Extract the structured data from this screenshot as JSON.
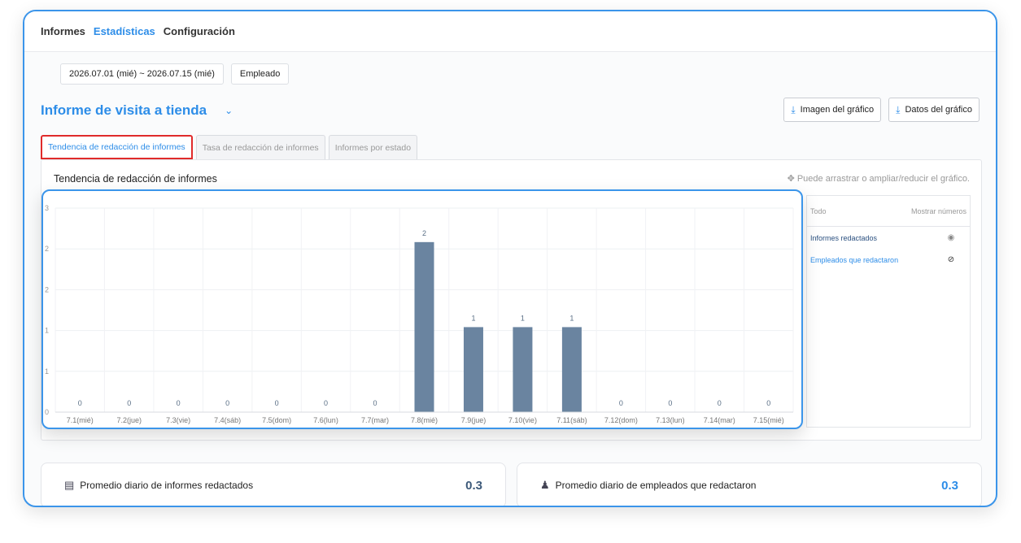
{
  "nav": [
    "Informes",
    "Estadísticas",
    "Configuración"
  ],
  "filters": {
    "date_range": "2026.07.01 (mié) ~ 2026.07.15 (mié)",
    "group": "Empleado"
  },
  "page_title": "Informe de visita a tienda",
  "downloads": {
    "image": "Imagen del gráfico",
    "data": "Datos del gráfico"
  },
  "tabs": [
    "Tendencia de redacción de informes",
    "Tasa de redacción de informes",
    "Informes por estado"
  ],
  "panel": {
    "title": "Tendencia de redacción de informes",
    "hint": "Puede arrastrar o ampliar/reducir el gráfico."
  },
  "legend": {
    "all": "Todo",
    "show_numbers": "Mostrar números",
    "items": [
      {
        "label": "Informes redactados",
        "color": "#2a4f7f",
        "icon": "eye-icon"
      },
      {
        "label": "Empleados que redactaron",
        "color": "#2d8de8",
        "icon": "eye-off-icon"
      }
    ]
  },
  "chart_data": {
    "type": "bar",
    "categories": [
      "7.1(mié)",
      "7.2(jue)",
      "7.3(vie)",
      "7.4(sáb)",
      "7.5(dom)",
      "7.6(lun)",
      "7.7(mar)",
      "7.8(mié)",
      "7.9(jue)",
      "7.10(vie)",
      "7.11(sáb)",
      "7.12(dom)",
      "7.13(lun)",
      "7.14(mar)",
      "7.15(mié)"
    ],
    "series": [
      {
        "name": "Informes redactados",
        "values": [
          0,
          0,
          0,
          0,
          0,
          0,
          0,
          2,
          1,
          1,
          1,
          0,
          0,
          0,
          0
        ]
      }
    ],
    "y_tick_labels": [
      "0",
      "1",
      "1",
      "2",
      "2",
      "3"
    ],
    "ylim": [
      0,
      2.4
    ],
    "grid": true,
    "bar_color": "#6a84a0"
  },
  "stats": [
    {
      "label": "Promedio diario de informes redactados",
      "value": "0.3",
      "color": "#3d5a7a",
      "icon": "report-icon"
    },
    {
      "label": "Promedio diario de empleados que redactaron",
      "value": "0.3",
      "color": "#2d8de8",
      "icon": "person-icon"
    }
  ]
}
